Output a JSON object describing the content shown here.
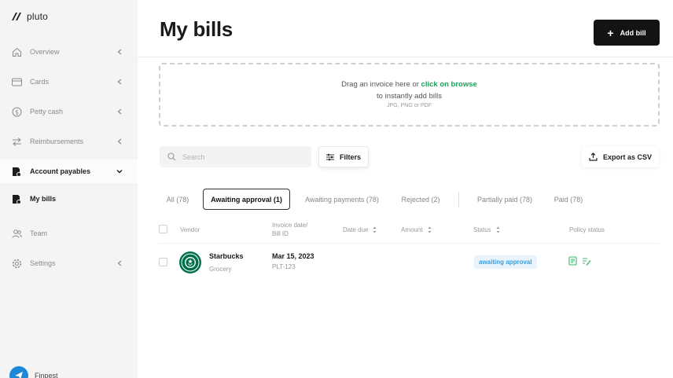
{
  "app": {
    "name": "pluto"
  },
  "sidebar": {
    "items": [
      {
        "label": "Overview",
        "icon": "home-icon"
      },
      {
        "label": "Cards",
        "icon": "card-icon"
      },
      {
        "label": "Petty cash",
        "icon": "dollar-icon"
      },
      {
        "label": "Reimbursements",
        "icon": "transfer-icon"
      },
      {
        "label": "Account payables",
        "icon": "bill-icon"
      },
      {
        "label": "My bills",
        "icon": "bill-icon"
      },
      {
        "label": "Team",
        "icon": "team-icon"
      },
      {
        "label": "Settings",
        "icon": "gear-icon"
      }
    ],
    "footer": {
      "name": "Finpest"
    }
  },
  "header": {
    "title": "My bills",
    "add_button": "Add bill"
  },
  "dropzone": {
    "line1_prefix": "Drag an invoice here or ",
    "line1_link": "click on browse",
    "line2": "to instantly add bills",
    "line3": "JPG, PNG or PDF"
  },
  "toolbar": {
    "search_placeholder": "Search",
    "filters_label": "Filters",
    "export_label": "Export as CSV"
  },
  "tabs": [
    {
      "label": "All (78)"
    },
    {
      "label": "Awaiting approval (1)"
    },
    {
      "label": "Awaiting payments (78)"
    },
    {
      "label": "Rejected (2)"
    },
    {
      "label": "Partially paid (78)"
    },
    {
      "label": "Paid (78)"
    }
  ],
  "table": {
    "headers": {
      "vendor": "Vendor",
      "invoice_line1": "Invoice date/",
      "invoice_line2": "Bill ID",
      "date_due": "Date due",
      "amount": "Amount",
      "status": "Status",
      "policy_status": "Policy status"
    },
    "rows": [
      {
        "vendor": "Starbucks",
        "category": "Grocery",
        "invoice_date": "Mar 15, 2023",
        "bill_id": "PLT-123",
        "status": "awaiting approval"
      }
    ]
  },
  "colors": {
    "accent_green": "#1aa35a",
    "status_blue": "#3b9ee0",
    "status_bg": "#e8f3fc",
    "primary_button": "#131313",
    "starbucks_green": "#00704a"
  }
}
